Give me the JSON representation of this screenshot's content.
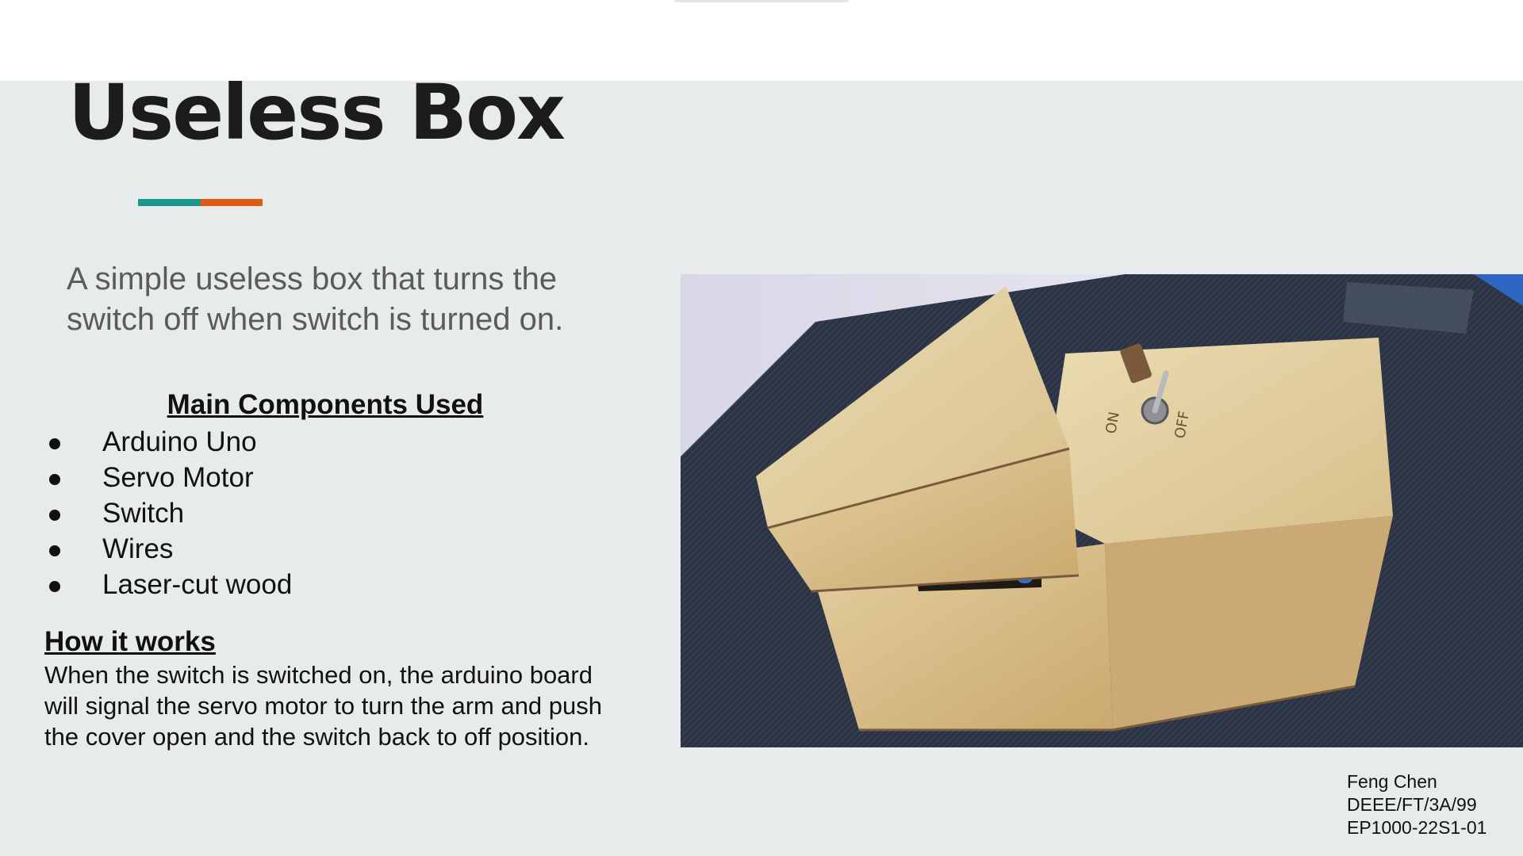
{
  "slide": {
    "title": "Useless Box",
    "subtitle": "A simple useless box that turns the switch off when switch is turned on.",
    "components": {
      "heading": "Main Components Used",
      "items": [
        "Arduino Uno",
        "Servo Motor",
        "Switch",
        "Wires",
        "Laser-cut wood"
      ]
    },
    "how": {
      "heading": "How it works",
      "body": "When the switch is switched on, the arduino board will signal the servo motor to turn the arm and push the cover open and the switch back to off position."
    },
    "photo": {
      "switch_on_label": "ON",
      "switch_off_label": "OFF"
    },
    "credit": [
      "Feng Chen",
      "DEEE/FT/3A/99",
      "EP1000-22S1-01"
    ]
  },
  "colors": {
    "slide_bg": "#e8ebec",
    "accent_teal": "#17988a",
    "accent_orange": "#e05b14",
    "title": "#1c1c1c",
    "subtitle": "#5b5b5b"
  }
}
